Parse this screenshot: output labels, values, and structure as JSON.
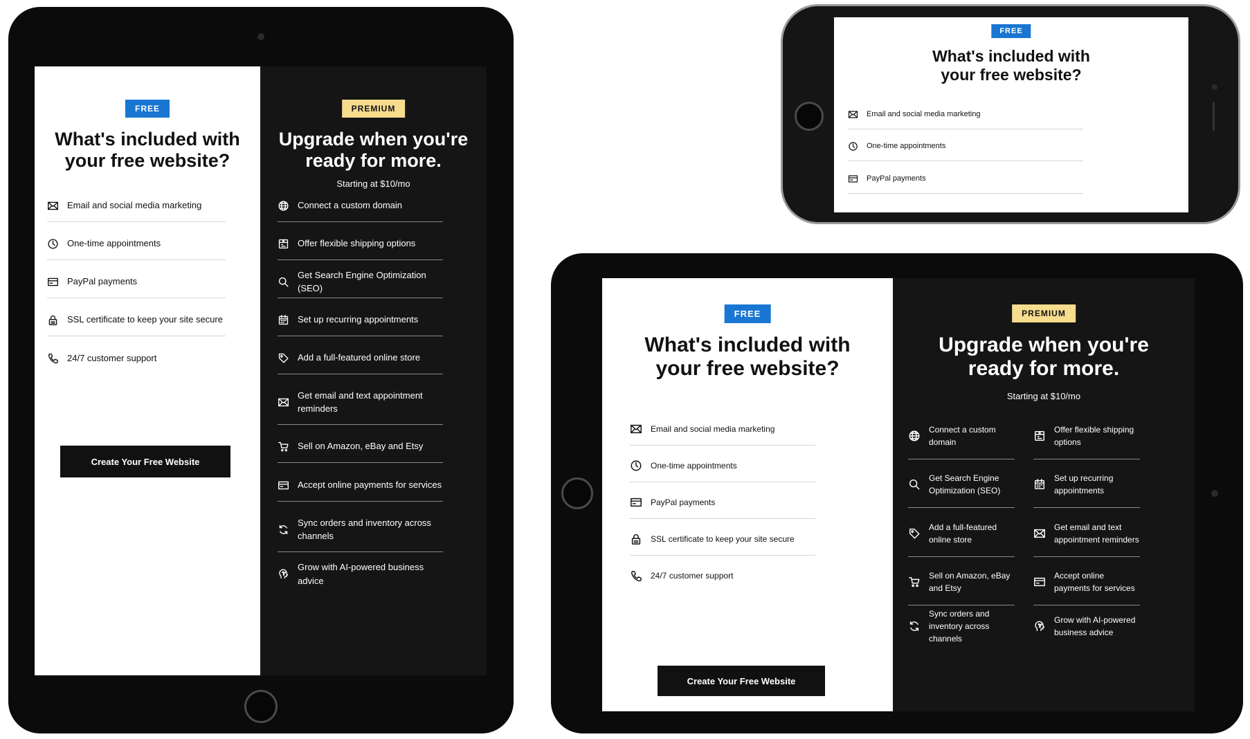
{
  "free": {
    "badge": "FREE",
    "heading": "What's included with your free website?",
    "features": [
      {
        "icon": "mail-icon",
        "label": "Email and social media marketing"
      },
      {
        "icon": "clock-icon",
        "label": "One-time appointments"
      },
      {
        "icon": "card-icon",
        "label": "PayPal payments"
      },
      {
        "icon": "lock-icon",
        "label": "SSL certificate to keep your site secure"
      },
      {
        "icon": "phone-icon",
        "label": "24/7 customer support"
      }
    ],
    "cta": "Create Your Free Website"
  },
  "premium": {
    "badge": "PREMIUM",
    "heading": "Upgrade when you're ready for more.",
    "subheading": "Starting at $10/mo",
    "features": [
      {
        "icon": "globe-icon",
        "label": "Connect a custom domain"
      },
      {
        "icon": "shipping-icon",
        "label": "Offer flexible shipping options"
      },
      {
        "icon": "search-icon",
        "label": "Get Search Engine Optimization (SEO)"
      },
      {
        "icon": "calendar-icon",
        "label": "Set up recurring appointments"
      },
      {
        "icon": "tag-icon",
        "label": "Add a full-featured online store"
      },
      {
        "icon": "mail-icon",
        "label": "Get email and text appointment reminders"
      },
      {
        "icon": "cart-icon",
        "label": "Sell on Amazon, eBay and Etsy"
      },
      {
        "icon": "card-icon",
        "label": "Accept online payments for services"
      },
      {
        "icon": "sync-icon",
        "label": "Sync orders and inventory across channels"
      },
      {
        "icon": "ai-head-icon",
        "label": "Grow with AI-powered business advice"
      }
    ]
  },
  "colors": {
    "free_badge": "#1976d2",
    "premium_badge": "#f6dc8d",
    "premium_panel": "#151515",
    "device_frame": "#0b0b0b",
    "cta_button": "#111111"
  }
}
